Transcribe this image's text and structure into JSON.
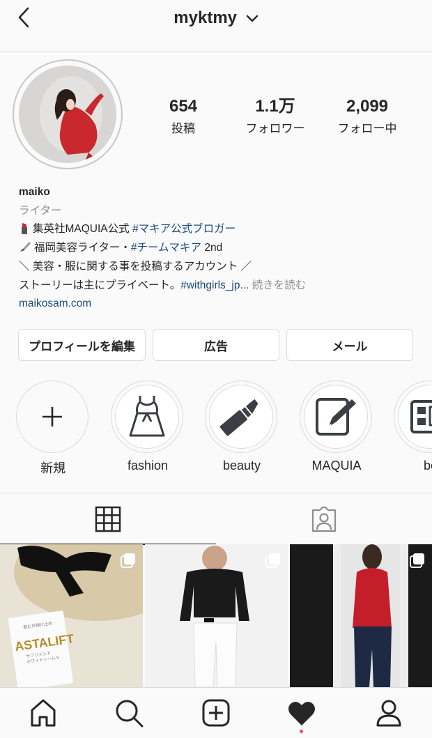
{
  "header": {
    "username": "myktmy"
  },
  "profile": {
    "stats": [
      {
        "value": "654",
        "label": "投稿"
      },
      {
        "value": "1.1万",
        "label": "フォロワー"
      },
      {
        "value": "2,099",
        "label": "フォロー中"
      }
    ],
    "name": "maiko",
    "category": "ライター",
    "bio": {
      "line1_prefix": "集英社MAQUIA公式 ",
      "line1_tag": "#マキア公式ブロガー",
      "line2_prefix": "福岡美容ライター・",
      "line2_tag": "#チームマキア",
      "line2_suffix": " 2nd",
      "line3": "＼ 美容・服に関する事を投稿するアカウント ／",
      "line4_prefix": "ストーリーは主にプライベート。",
      "line4_tag": "#withgirls_jp...",
      "line4_more": " 続きを読む"
    },
    "website": "maikosam.com"
  },
  "buttons": {
    "edit_profile": "プロフィールを編集",
    "ads": "広告",
    "mail": "メール"
  },
  "highlights": [
    {
      "label": "新規",
      "icon": "plus-icon"
    },
    {
      "label": "fashion",
      "icon": "dress-icon"
    },
    {
      "label": "beauty",
      "icon": "lipstick-icon"
    },
    {
      "label": "MAQUIA",
      "icon": "pen-paper-icon"
    },
    {
      "label": "bo",
      "icon": "palette-icon"
    }
  ],
  "posts": [
    {
      "alt": "ASTALIFT",
      "sub1": "飲む日焼け止め",
      "sub2": "サプリメント",
      "sub3": "ホワイトシールド"
    },
    {
      "alt": "outfit-photo"
    },
    {
      "alt": "mirror-photo"
    }
  ],
  "colors": {
    "accent_link": "#1d4b7a",
    "notification_dot": "#ed4956",
    "border": "#dbdbdb"
  }
}
